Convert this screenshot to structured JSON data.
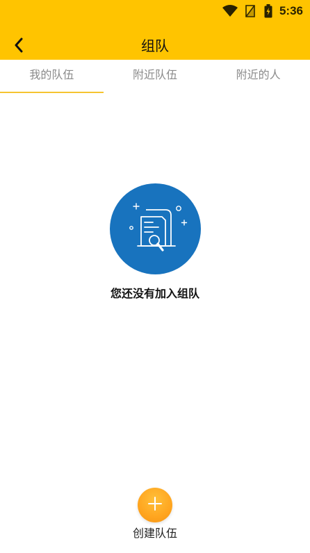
{
  "status_bar": {
    "time": "5:36",
    "icons": [
      "wifi-icon",
      "no-signal-icon",
      "battery-charging-icon"
    ]
  },
  "header": {
    "title": "组队",
    "back_icon": "chevron-left-icon"
  },
  "tabs": [
    {
      "label": "我的队伍",
      "active": true
    },
    {
      "label": "附近队伍",
      "active": false
    },
    {
      "label": "附近的人",
      "active": false
    }
  ],
  "empty_state": {
    "icon": "empty-documents-search-icon",
    "message": "您还没有加入组队"
  },
  "create_team": {
    "icon": "plus-icon",
    "label": "创建队伍"
  },
  "colors": {
    "header": "#FFC400",
    "tab_indicator": "#F5C430",
    "illustration": "#1873BE",
    "fab": "#FFA51F"
  }
}
